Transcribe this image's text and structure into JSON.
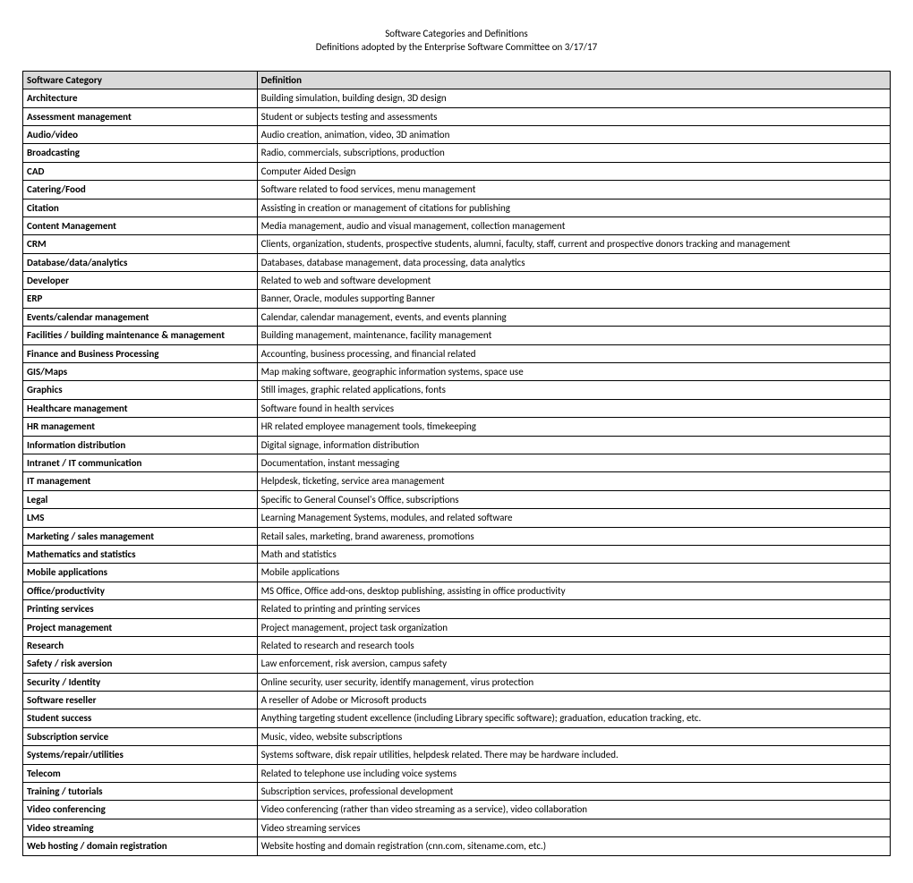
{
  "header": {
    "title": "Software Categories and Definitions",
    "subtitle": "Definitions adopted by the Enterprise Software Committee on 3/17/17"
  },
  "table": {
    "columns": {
      "category": "Software Category",
      "definition": "Definition"
    },
    "rows": [
      {
        "category": "Architecture",
        "definition": "Building simulation, building design, 3D design"
      },
      {
        "category": "Assessment management",
        "definition": "Student or subjects testing and assessments"
      },
      {
        "category": "Audio/video",
        "definition": "Audio creation, animation, video, 3D animation"
      },
      {
        "category": "Broadcasting",
        "definition": "Radio, commercials, subscriptions, production"
      },
      {
        "category": "CAD",
        "definition": "Computer Aided Design"
      },
      {
        "category": "Catering/Food",
        "definition": "Software related to food services, menu management"
      },
      {
        "category": "Citation",
        "definition": "Assisting in creation or management of citations for publishing"
      },
      {
        "category": "Content Management",
        "definition": "Media management, audio and visual management, collection management"
      },
      {
        "category": "CRM",
        "definition": "Clients, organization, students, prospective students, alumni, faculty, staff, current and prospective donors tracking and management"
      },
      {
        "category": "Database/data/analytics",
        "definition": "Databases, database management, data processing, data analytics"
      },
      {
        "category": "Developer",
        "definition": "Related to web and software development"
      },
      {
        "category": "ERP",
        "definition": "Banner, Oracle, modules supporting Banner"
      },
      {
        "category": "Events/calendar management",
        "definition": "Calendar, calendar management, events, and events planning"
      },
      {
        "category": "Facilities / building maintenance & management",
        "definition": "Building management, maintenance, facility management"
      },
      {
        "category": "Finance and Business Processing",
        "definition": "Accounting, business processing, and financial related"
      },
      {
        "category": "GIS/Maps",
        "definition": "Map making software, geographic information systems, space use"
      },
      {
        "category": "Graphics",
        "definition": "Still images, graphic related applications, fonts"
      },
      {
        "category": "Healthcare management",
        "definition": "Software found in health services"
      },
      {
        "category": "HR management",
        "definition": "HR related employee management tools, timekeeping"
      },
      {
        "category": "Information distribution",
        "definition": "Digital signage, information distribution"
      },
      {
        "category": "Intranet / IT communication",
        "definition": "Documentation, instant messaging"
      },
      {
        "category": "IT management",
        "definition": "Helpdesk, ticketing, service area management"
      },
      {
        "category": "Legal",
        "definition": "Specific to General Counsel's Office, subscriptions"
      },
      {
        "category": "LMS",
        "definition": "Learning Management Systems, modules, and related software"
      },
      {
        "category": "Marketing / sales management",
        "definition": "Retail sales, marketing, brand awareness, promotions"
      },
      {
        "category": "Mathematics and statistics",
        "definition": "Math and statistics"
      },
      {
        "category": "Mobile applications",
        "definition": "Mobile applications"
      },
      {
        "category": "Office/productivity",
        "definition": "MS Office, Office add-ons, desktop publishing, assisting in office productivity"
      },
      {
        "category": "Printing services",
        "definition": "Related to printing and printing services"
      },
      {
        "category": "Project management",
        "definition": "Project management, project task organization"
      },
      {
        "category": "Research",
        "definition": "Related to research and research tools"
      },
      {
        "category": "Safety / risk aversion",
        "definition": "Law enforcement, risk aversion, campus safety"
      },
      {
        "category": "Security / Identity",
        "definition": "Online security, user security, identify management, virus protection"
      },
      {
        "category": "Software reseller",
        "definition": "A reseller of Adobe or Microsoft products"
      },
      {
        "category": "Student success",
        "definition": "Anything targeting student excellence (including Library specific software); graduation, education tracking, etc."
      },
      {
        "category": "Subscription service",
        "definition": "Music, video, website subscriptions"
      },
      {
        "category": "Systems/repair/utilities",
        "definition": "Systems software, disk repair utilities, helpdesk related. There may be hardware included."
      },
      {
        "category": "Telecom",
        "definition": "Related to telephone use including voice systems"
      },
      {
        "category": "Training / tutorials",
        "definition": "Subscription services, professional development"
      },
      {
        "category": "Video conferencing",
        "definition": "Video conferencing (rather than video streaming as a service), video collaboration"
      },
      {
        "category": "Video streaming",
        "definition": "Video streaming services"
      },
      {
        "category": "Web hosting / domain registration",
        "definition": "Website hosting and domain registration (cnn.com, sitename.com, etc.)"
      }
    ]
  }
}
